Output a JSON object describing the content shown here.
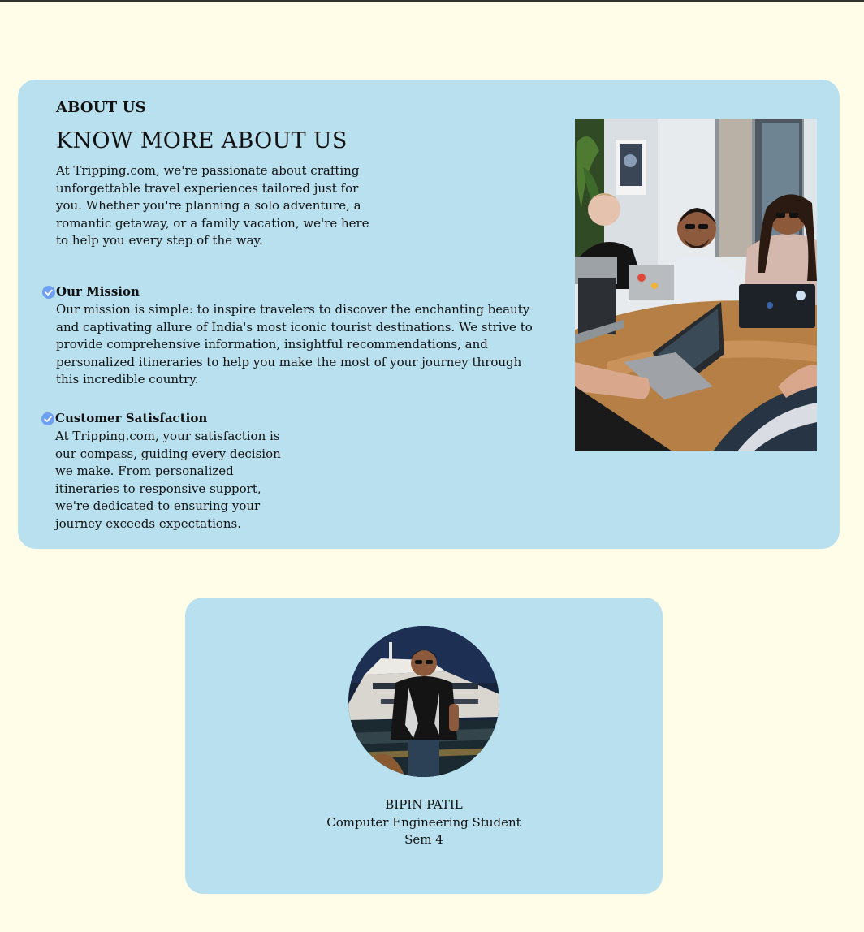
{
  "about": {
    "eyebrow": "ABOUT US",
    "headline": "KNOW MORE ABOUT US",
    "intro": "At Tripping.com, we're passionate about crafting unforgettable travel experiences tailored just for you. Whether you're planning a solo adventure, a romantic getaway, or a family vacation, we're here to help you every step of the way.",
    "features": [
      {
        "icon": "check-circle-icon",
        "title": "Our Mission",
        "body": "Our mission is simple: to inspire travelers to discover the enchanting beauty and captivating allure of India's most iconic tourist destinations. We strive to provide comprehensive information, insightful recommendations, and personalized itineraries to help you make the most of your journey through this incredible country."
      },
      {
        "icon": "check-circle-icon",
        "title": "Customer Satisfaction",
        "body": "At Tripping.com, your satisfaction is our compass, guiding every decision we make. From personalized itineraries to responsive support, we're dedicated to ensuring your journey exceeds expectations."
      }
    ],
    "accent_color": "#6e9ff0",
    "card_color": "#b8e0ef"
  },
  "profile": {
    "name": "BIPIN PATIL",
    "role": "Computer Engineering Student",
    "semester": "Sem 4"
  },
  "colors": {
    "page_background": "#fffde8",
    "card_background": "#b8e0ef",
    "check_icon": "#6e9ff0"
  }
}
